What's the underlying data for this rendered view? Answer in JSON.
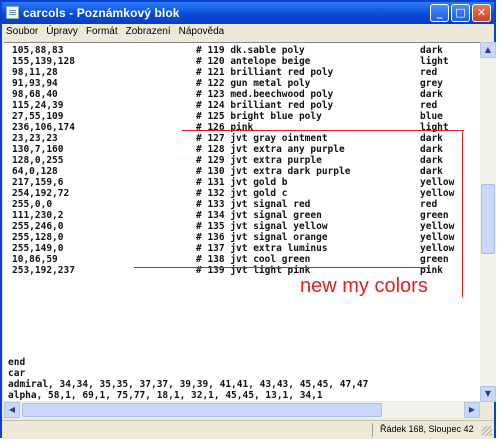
{
  "window": {
    "title": "carcols - Poznámkový blok"
  },
  "title_buttons": {
    "minimize": "_",
    "maximize": "□",
    "close": "✕"
  },
  "menu": [
    "Soubor",
    "Úpravy",
    "Formát",
    "Zobrazení",
    "Nápověda"
  ],
  "rows": [
    {
      "rgb": "105,88,83",
      "entry": "# 119 dk.sable poly",
      "shade": "dark"
    },
    {
      "rgb": "155,139,128",
      "entry": "# 120 antelope beige",
      "shade": "light"
    },
    {
      "rgb": "98,11,28",
      "entry": "# 121 brilliant red poly",
      "shade": "red"
    },
    {
      "rgb": "91,93,94",
      "entry": "# 122 gun metal poly",
      "shade": "grey"
    },
    {
      "rgb": "98,68,40",
      "entry": "# 123 med.beechwood poly",
      "shade": "dark"
    },
    {
      "rgb": "115,24,39",
      "entry": "# 124 brilliant red poly",
      "shade": "red"
    },
    {
      "rgb": "27,55,109",
      "entry": "# 125 bright blue poly",
      "shade": "blue"
    },
    {
      "rgb": "236,106,174",
      "entry": "# 126 pink",
      "shade": "light"
    },
    {
      "rgb": "23,23,23",
      "entry": "# 127 jvt gray ointment",
      "shade": "dark"
    },
    {
      "rgb": "130,7,160",
      "entry": "# 128 jvt extra any purple",
      "shade": "dark"
    },
    {
      "rgb": "128,0,255",
      "entry": "# 129 jvt extra purple",
      "shade": "dark"
    },
    {
      "rgb": "64,0,128",
      "entry": "# 130 jvt extra dark purple",
      "shade": "dark"
    },
    {
      "rgb": "217,159,6",
      "entry": "# 131 jvt gold b",
      "shade": "yellow"
    },
    {
      "rgb": "254,192,72",
      "entry": "# 132 jvt gold c",
      "shade": "yellow"
    },
    {
      "rgb": "255,0,0",
      "entry": "# 133 jvt signal red",
      "shade": "red"
    },
    {
      "rgb": "111,230,2",
      "entry": "# 134 jvt signal green",
      "shade": "green"
    },
    {
      "rgb": "255,246,0",
      "entry": "# 135 jvt signal yellow",
      "shade": "yellow"
    },
    {
      "rgb": "255,128,0",
      "entry": "# 136 jvt signal orange",
      "shade": "yellow"
    },
    {
      "rgb": "255,149,0",
      "entry": "# 137 jvt extra luminus",
      "shade": "yellow"
    },
    {
      "rgb": "10,86,59",
      "entry": "# 138 jvt cool green",
      "shade": "green"
    },
    {
      "rgb": "253,192,237",
      "entry": "# 139 jvt light pink",
      "shade": "pink"
    }
  ],
  "tail_lines": [
    "end",
    "car",
    "admiral, 34,34, 35,35, 37,37, 39,39, 41,41, 43,43, 45,45, 47,47",
    "alpha, 58,1, 69,1, 75,77, 18,1, 32,1, 45,45, 13,1, 34,1"
  ],
  "annotation": {
    "text": "new my colors",
    "color": "#e02020"
  },
  "status": {
    "position": "Řádek 168, Sloupec 42"
  }
}
